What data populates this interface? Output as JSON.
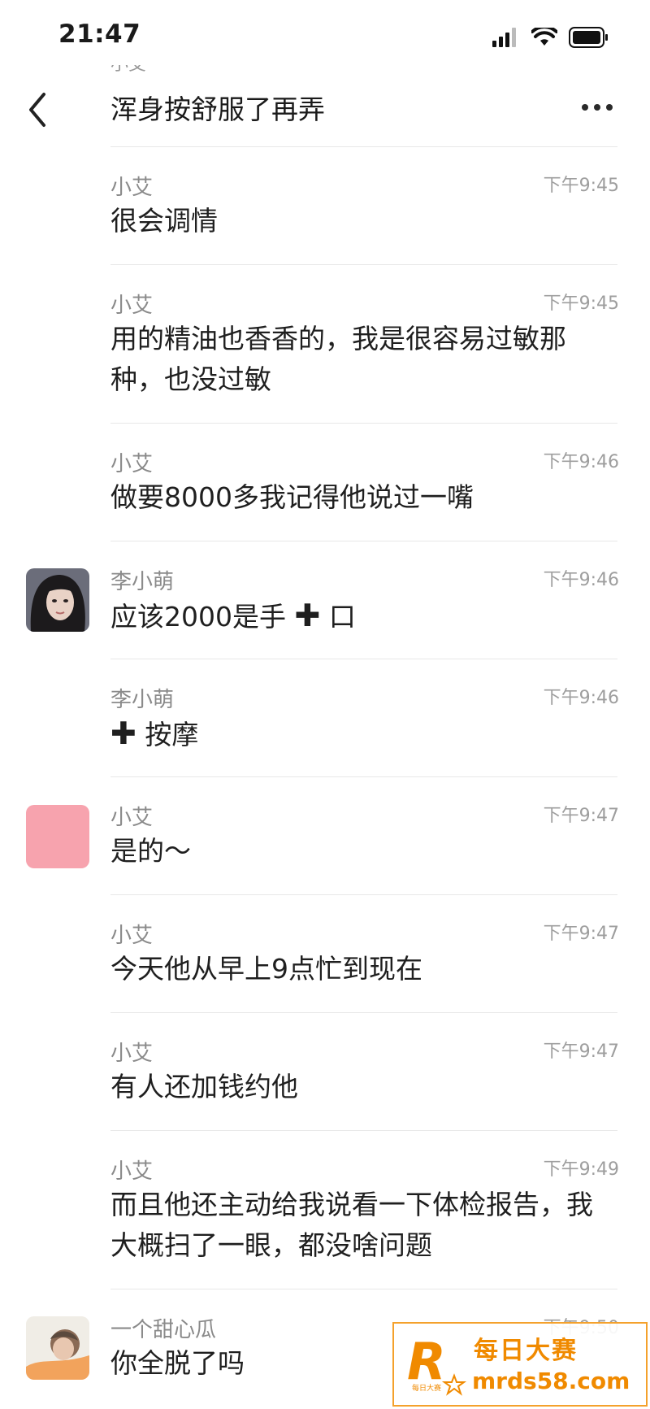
{
  "status_bar": {
    "time": "21:47"
  },
  "nav": {
    "clipped_text": "小艾",
    "title": "浑身按舒服了再弄"
  },
  "messages": [
    {
      "sender": "小艾",
      "time": "下午9:45",
      "lines": [
        "很会调情"
      ]
    },
    {
      "sender": "小艾",
      "time": "下午9:45",
      "lines": [
        "用的精油也香香的，我是很容易过敏那",
        "种，也没过敏"
      ]
    },
    {
      "sender": "小艾",
      "time": "下午9:46",
      "lines": [
        "做要8000多我记得他说过一嘴"
      ]
    },
    {
      "sender": "李小萌",
      "time": "下午9:46",
      "text_before": "应该2000是手",
      "plus": "✚",
      "text_after": " 口"
    },
    {
      "sender": "李小萌",
      "time": "下午9:46",
      "plus": "✚",
      "text_after": " 按摩"
    },
    {
      "sender": "小艾",
      "time": "下午9:47",
      "lines": [
        "是的～"
      ]
    },
    {
      "sender": "小艾",
      "time": "下午9:47",
      "lines": [
        "今天他从早上9点忙到现在"
      ]
    },
    {
      "sender": "小艾",
      "time": "下午9:47",
      "lines": [
        "有人还加钱约他"
      ]
    },
    {
      "sender": "小艾",
      "time": "下午9:49",
      "lines": [
        "而且他还主动给我说看一下体检报告，我",
        "大概扫了一眼，都没啥问题"
      ]
    },
    {
      "sender": "一个甜心瓜",
      "time": "下午9:50",
      "lines": [
        "你全脱了吗"
      ]
    }
  ],
  "watermark": {
    "title": "每日大赛",
    "url": "mrds58.com",
    "logo_letter": "R",
    "logo_small": "每日大赛"
  },
  "colors": {
    "avatar_pink": "#f7a3ae",
    "watermark_orange": "#f08a00"
  },
  "icons": [
    "signal-icon",
    "wifi-icon",
    "battery-icon",
    "back-chevron-icon",
    "more-dots-icon"
  ]
}
